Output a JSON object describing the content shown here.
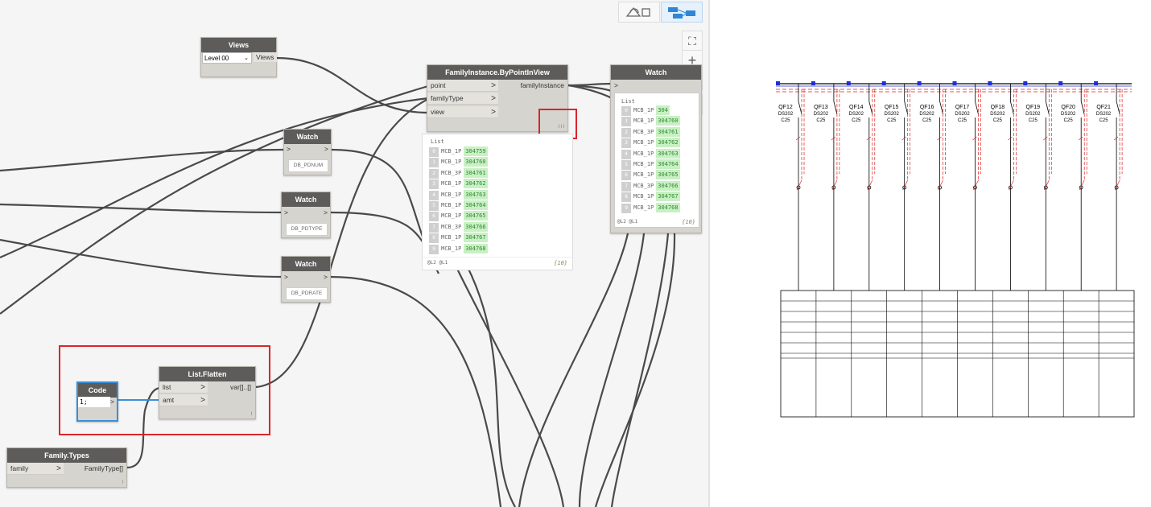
{
  "toolbar": {
    "geometry_view_icon": "geometry-view-icon",
    "graph_view_icon": "graph-view-icon"
  },
  "zoom_controls": {
    "fit": "⛶",
    "zoom_in": "+",
    "zoom_out": "−",
    "pan": "✥"
  },
  "nodes": {
    "views": {
      "title": "Views",
      "selected": "Level 00",
      "output": "Views"
    },
    "family_instance": {
      "title": "FamilyInstance.ByPointInView",
      "inputs": [
        "point",
        "familyType",
        "view"
      ],
      "output": "familyInstance",
      "lacing": "l l l"
    },
    "watch_pdnum": {
      "title": "Watch",
      "in": ">",
      "out": ">",
      "value": "DB_PDNUM"
    },
    "watch_pdtype": {
      "title": "Watch",
      "in": ">",
      "out": ">",
      "value": "DB_PDTYPE"
    },
    "watch_pdrate": {
      "title": "Watch",
      "in": ">",
      "out": ">",
      "value": "DB_PDRATE"
    },
    "watch_main": {
      "title": "Watch",
      "in": ">"
    },
    "code_block": {
      "title": "Code Block",
      "code": "1;",
      "out": ">"
    },
    "list_flatten": {
      "title": "List.Flatten",
      "inputs": [
        "list",
        "amt"
      ],
      "output": "var[]..[]",
      "lacing": "l"
    },
    "family_types": {
      "title": "Family.Types",
      "input": "family",
      "output": "FamilyType[]",
      "lacing": "l"
    }
  },
  "preview_center": {
    "header": "List",
    "rows": [
      {
        "idx": "0",
        "name": "MCB_1P",
        "val": "304759"
      },
      {
        "idx": "1",
        "name": "MCB_1P",
        "val": "304760"
      },
      {
        "idx": "2",
        "name": "MCB_3P",
        "val": "304761"
      },
      {
        "idx": "3",
        "name": "MCB_1P",
        "val": "304762"
      },
      {
        "idx": "4",
        "name": "MCB_1P",
        "val": "304763"
      },
      {
        "idx": "5",
        "name": "MCB_1P",
        "val": "304764"
      },
      {
        "idx": "6",
        "name": "MCB_1P",
        "val": "304765"
      },
      {
        "idx": "7",
        "name": "MCB_3P",
        "val": "304766"
      },
      {
        "idx": "8",
        "name": "MCB_1P",
        "val": "304767"
      },
      {
        "idx": "9",
        "name": "MCB_1P",
        "val": "304768"
      }
    ],
    "footer_left": "@L2 @L1",
    "footer_right": "{10}"
  },
  "preview_watch": {
    "header": "List",
    "rows": [
      {
        "idx": "0",
        "name": "MCB_1P",
        "val": "304"
      },
      {
        "idx": "1",
        "name": "MCB_1P",
        "val": "304760"
      },
      {
        "idx": "2",
        "name": "MCB_3P",
        "val": "304761"
      },
      {
        "idx": "3",
        "name": "MCB_1P",
        "val": "304762"
      },
      {
        "idx": "4",
        "name": "MCB_1P",
        "val": "304763"
      },
      {
        "idx": "5",
        "name": "MCB_1P",
        "val": "304764"
      },
      {
        "idx": "6",
        "name": "MCB_1P",
        "val": "304765"
      },
      {
        "idx": "7",
        "name": "MCB_3P",
        "val": "304766"
      },
      {
        "idx": "8",
        "name": "MCB_1P",
        "val": "304767"
      },
      {
        "idx": "9",
        "name": "MCB_1P",
        "val": "304768"
      }
    ],
    "footer_left": "@L2 @L1",
    "footer_right": "{10}"
  },
  "schematic": {
    "breakers": [
      {
        "id": "QF12",
        "model": "DS202",
        "rating": "C25"
      },
      {
        "id": "QF13",
        "model": "DS202",
        "rating": "C25"
      },
      {
        "id": "QF14",
        "model": "DS202",
        "rating": "C25"
      },
      {
        "id": "QF15",
        "model": "DS202",
        "rating": "C25"
      },
      {
        "id": "QF16",
        "model": "DS202",
        "rating": "C25"
      },
      {
        "id": "QF17",
        "model": "DS202",
        "rating": "C25"
      },
      {
        "id": "QF18",
        "model": "DS202",
        "rating": "C25"
      },
      {
        "id": "QF19",
        "model": "DS202",
        "rating": "C25"
      },
      {
        "id": "QF20",
        "model": "DS202",
        "rating": "C25"
      },
      {
        "id": "QF21",
        "model": "DS202",
        "rating": "C25"
      }
    ],
    "colors": {
      "line": "#000000",
      "dashed": "#e02020",
      "node": "#1f2fd6"
    }
  }
}
